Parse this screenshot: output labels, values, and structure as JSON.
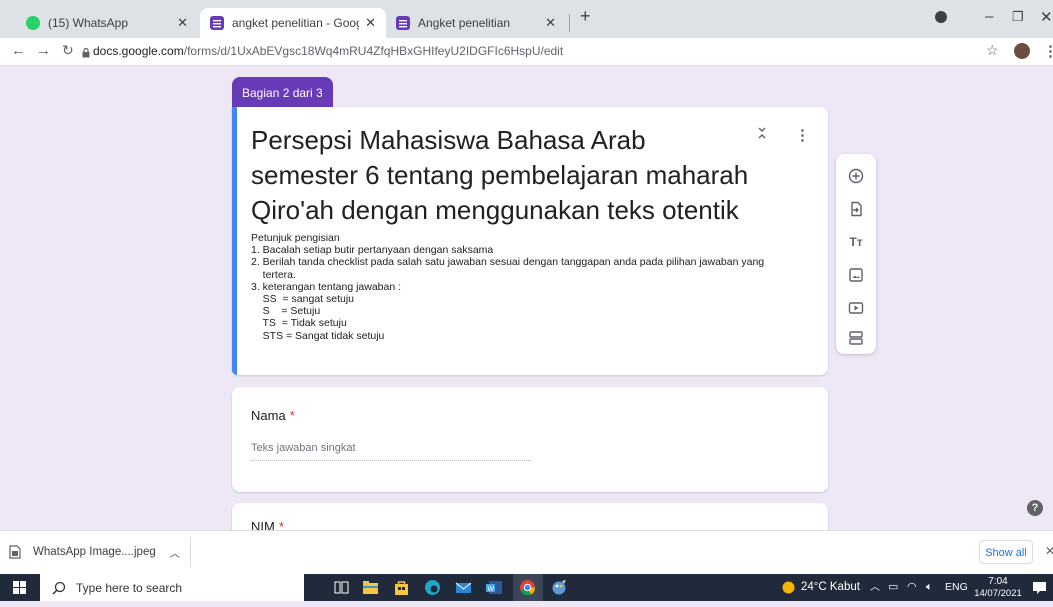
{
  "browser": {
    "tabs": [
      {
        "label": "(15) WhatsApp",
        "active": false
      },
      {
        "label": "angket penelitian - Google Form",
        "active": true
      },
      {
        "label": "Angket penelitian",
        "active": false
      }
    ],
    "new_tab": "+",
    "url_host": "docs.google.com",
    "url_path": "/forms/d/1UxAbEVgsc18Wq4mRU4ZfqHBxGHIfeyU2IDGFIc6HspU/edit"
  },
  "form": {
    "section_tag": "Bagian 2 dari 3",
    "title": "Persepsi Mahasiswa Bahasa Arab semester 6 tentang pembelajaran maharah Qiro'ah dengan menggunakan teks otentik",
    "description": "Petunjuk pengisian\n1. Bacalah setiap butir pertanyaan dengan saksama\n2. Berilah tanda checklist pada salah satu jawaban sesuai dengan tanggapan anda pada pilihan jawaban yang\n    tertera.\n3. keterangan tentang jawaban :\n    SS  = sangat setuju\n    S    = Setuju\n    TS  = Tidak setuju\n    STS = Sangat tidak setuju",
    "questions": [
      {
        "label": "Nama",
        "required": "*",
        "placeholder": "Teks jawaban singkat"
      },
      {
        "label": "NIM",
        "required": "*"
      }
    ]
  },
  "downloads": {
    "file": "WhatsApp Image....jpeg",
    "show_all": "Show all"
  },
  "taskbar": {
    "search_placeholder": "Type here to search",
    "weather": "24°C  Kabut",
    "lang": "ENG",
    "time": "7:04",
    "date": "14/07/2021"
  },
  "colors": {
    "accent": "#673ab7",
    "blue": "#4285f4",
    "background": "#ede7f6"
  }
}
